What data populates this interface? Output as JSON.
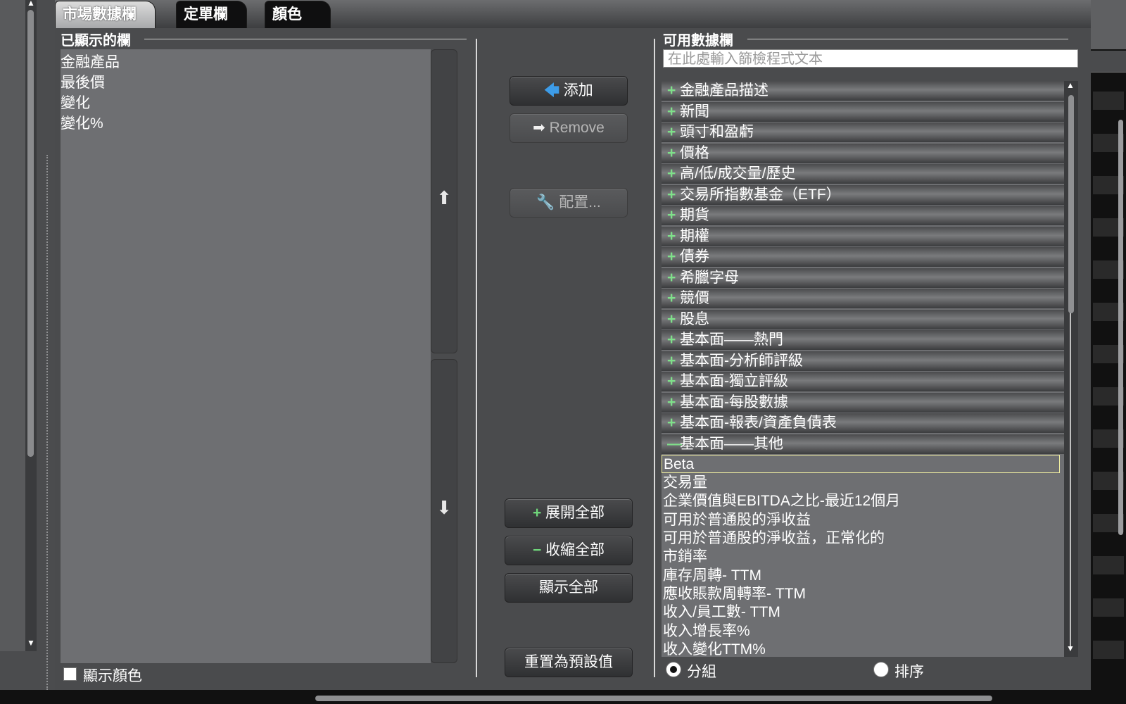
{
  "tabs": [
    {
      "label": "市場數據欄",
      "active": true
    },
    {
      "label": "定單欄",
      "active": false
    },
    {
      "label": "顏色",
      "active": false
    }
  ],
  "shown_panel": {
    "title": "已顯示的欄",
    "items": [
      "金融產品",
      "最後價",
      "變化",
      "變化%"
    ],
    "show_color_label": "顯示顏色",
    "show_color_checked": false
  },
  "buttons": {
    "add_label": "添加",
    "remove_label": "Remove",
    "configure_label": "配置...",
    "expand_all_label": "展開全部",
    "collapse_all_label": "收縮全部",
    "show_all_label": "顯示全部",
    "reset_label": "重置為預設值"
  },
  "available_panel": {
    "title": "可用數據欄",
    "filter_placeholder": "在此處輸入篩檢程式文本",
    "categories": [
      {
        "label": "金融產品描述",
        "expanded": false
      },
      {
        "label": "新聞",
        "expanded": false
      },
      {
        "label": "頭寸和盈虧",
        "expanded": false
      },
      {
        "label": "價格",
        "expanded": false
      },
      {
        "label": "高/低/成交量/歷史",
        "expanded": false
      },
      {
        "label": "交易所指數基金（ETF）",
        "expanded": false
      },
      {
        "label": "期貨",
        "expanded": false
      },
      {
        "label": "期權",
        "expanded": false
      },
      {
        "label": "債券",
        "expanded": false
      },
      {
        "label": "希臘字母",
        "expanded": false
      },
      {
        "label": "競價",
        "expanded": false
      },
      {
        "label": "股息",
        "expanded": false
      },
      {
        "label": "基本面——熱門",
        "expanded": false
      },
      {
        "label": "基本面-分析師評級",
        "expanded": false
      },
      {
        "label": "基本面-獨立評級",
        "expanded": false
      },
      {
        "label": "基本面-每股數據",
        "expanded": false
      },
      {
        "label": "基本面-報表/資產負債表",
        "expanded": false
      },
      {
        "label": "基本面——其他",
        "expanded": true
      }
    ],
    "expanded_items": [
      "Beta",
      "交易量",
      "企業價值與EBITDA之比-最近12個月",
      "可用於普通股的淨收益",
      "可用於普通股的淨收益，正常化的",
      "市銷率",
      "庫存周轉- TTM",
      "應收賬款周轉率- TTM",
      "收入/員工數- TTM",
      "收入增長率%",
      "收入變化TTM%"
    ],
    "selected_item": "Beta",
    "view_mode": {
      "group_label": "分組",
      "sort_label": "排序",
      "selected": "group"
    }
  },
  "colors": {
    "accent_blue": "#3d9ce8",
    "accent_green": "#7fe08a",
    "selected_border": "#f0eea0"
  }
}
